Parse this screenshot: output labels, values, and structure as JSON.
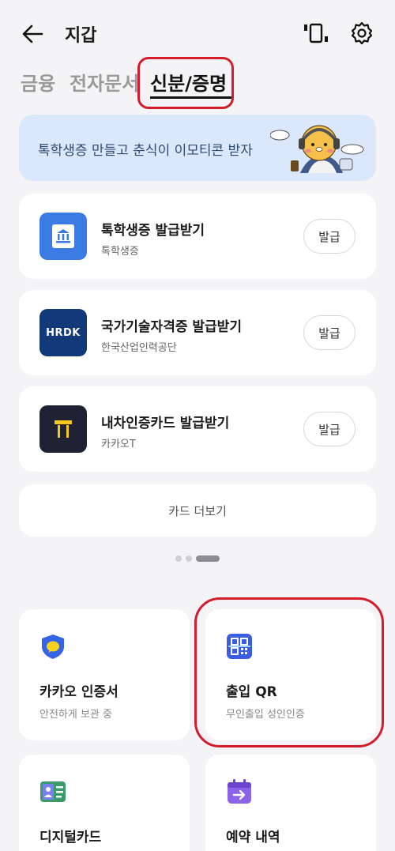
{
  "header": {
    "title": "지갑",
    "back_icon": "arrow-left-icon",
    "device_icon": "device-frame-icon",
    "settings_icon": "gear-icon"
  },
  "tabs": [
    {
      "label": "금융",
      "active": false
    },
    {
      "label": "전자문서",
      "active": false
    },
    {
      "label": "신분/증명",
      "active": true
    }
  ],
  "banner": {
    "text": "톡학생증 만들고 춘식이 이모티콘 받자"
  },
  "cards": [
    {
      "name": "톡학생증 발급받기",
      "sub": "톡학생증",
      "button": "발급",
      "logo_color": "#3b7be4",
      "icon": "bank-building-icon"
    },
    {
      "name": "국가기술자격증 발급받기",
      "sub": "한국산업인력공단",
      "button": "발급",
      "logo_color": "#123a7a",
      "logo_text": "HRDK",
      "icon": "hrdk-logo"
    },
    {
      "name": "내차인증카드 발급받기",
      "sub": "카카오T",
      "button": "발급",
      "logo_color": "#1f2233",
      "logo_text": "T",
      "icon": "kakao-t-logo"
    }
  ],
  "more_label": "카드 더보기",
  "pager": {
    "current": 3,
    "total": 3
  },
  "tiles": [
    {
      "name": "카카오 인증서",
      "sub": "안전하게 보관 중",
      "icon": "shield-icon",
      "color": "#3564e6"
    },
    {
      "name": "출입 QR",
      "sub": "무인출입 성인인증",
      "icon": "qr-code-icon",
      "color": "#3b5ee0"
    },
    {
      "name": "디지털카드",
      "sub": "",
      "icon": "id-card-icon",
      "color": "#3a9a6a"
    },
    {
      "name": "예약 내역",
      "sub": "",
      "icon": "calendar-arrow-icon",
      "color": "#8a63e8"
    }
  ]
}
